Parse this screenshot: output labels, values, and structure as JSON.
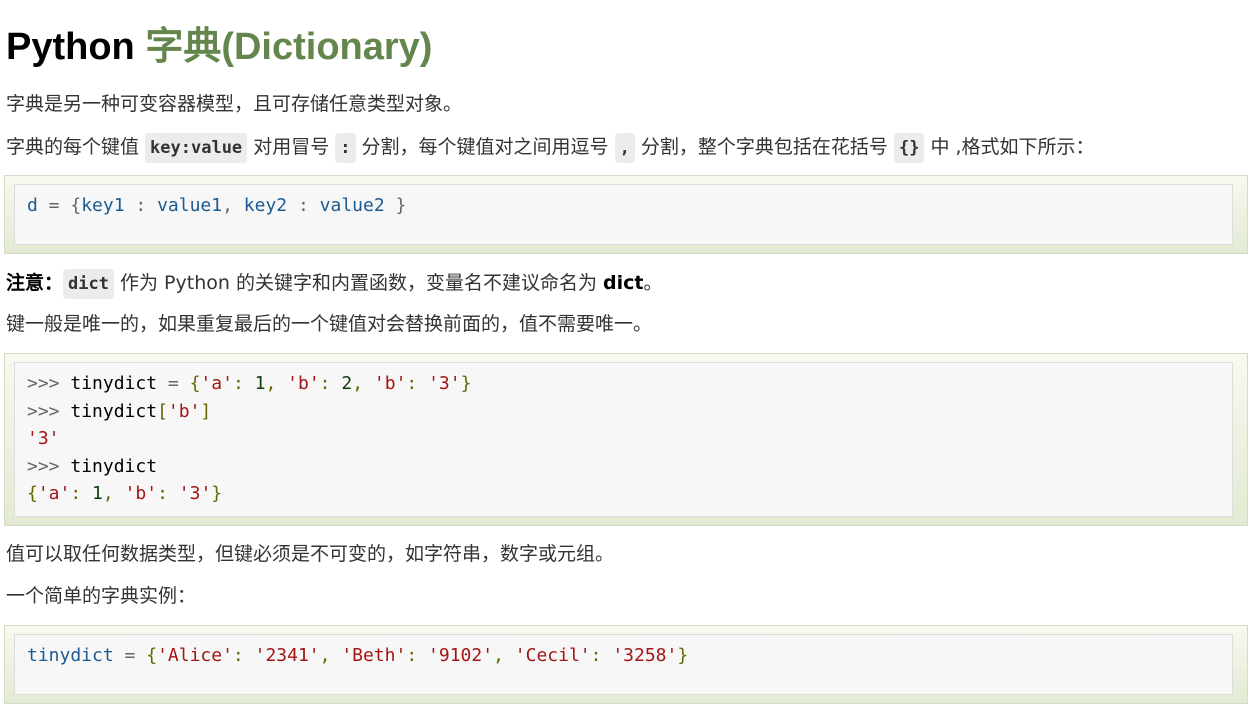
{
  "title": {
    "prefix": "Python ",
    "highlight": "字典(Dictionary)"
  },
  "para1": "字典是另一种可变容器模型，且可存储任意类型对象。",
  "para2": {
    "t1": "字典的每个键值 ",
    "c1": "key:value",
    "t2": " 对用冒号 ",
    "c2": ":",
    "t3": " 分割，每个键值对之间用逗号 ",
    "c3": ",",
    "t4": " 分割，整个字典包括在花括号 ",
    "c4": "{}",
    "t5": " 中 ,格式如下所示："
  },
  "code1": {
    "var": "d",
    "eq": " = ",
    "open": "{",
    "k1": "key1",
    "colon1": " : ",
    "v1": "value1",
    "comma": ", ",
    "k2": "key2",
    "colon2": " : ",
    "v2": "value2",
    "close": " }"
  },
  "note": {
    "label": "注意：",
    "code": "dict",
    "text": " 作为 Python 的关键字和内置函数，变量名不建议命名为 ",
    "bold": "dict",
    "end": "。"
  },
  "para3": "键一般是唯一的，如果重复最后的一个键值对会替换前面的，值不需要唯一。",
  "code2": {
    "prompt": ">>> ",
    "name": "tinydict",
    "eq": " = ",
    "line1_dict": [
      "{",
      "'a'",
      ": ",
      "1",
      ", ",
      "'b'",
      ": ",
      "2",
      ", ",
      "'b'",
      ": ",
      "'3'",
      "}"
    ],
    "line2_open": "[",
    "line2_key": "'b'",
    "line2_close": "]",
    "line3": "'3'",
    "line5": [
      "{",
      "'a'",
      ": ",
      "1",
      ", ",
      "'b'",
      ": ",
      "'3'",
      "}"
    ]
  },
  "para4": "值可以取任何数据类型，但键必须是不可变的，如字符串，数字或元组。",
  "para5": "一个简单的字典实例：",
  "code3": {
    "var": "tinydict",
    "eq": " = ",
    "items": [
      "{",
      "'Alice'",
      ": ",
      "'2341'",
      ", ",
      "'Beth'",
      ": ",
      "'9102'",
      ", ",
      "'Cecil'",
      ": ",
      "'3258'",
      "}"
    ]
  }
}
